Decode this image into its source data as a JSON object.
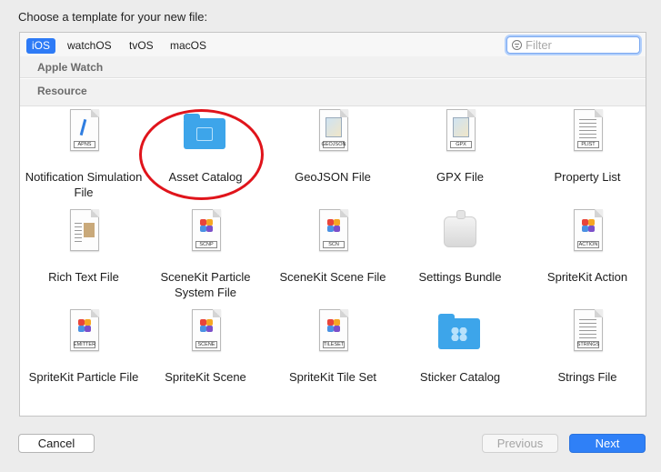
{
  "prompt": "Choose a template for your new file:",
  "tabs": [
    "iOS",
    "watchOS",
    "tvOS",
    "macOS"
  ],
  "active_tab": "iOS",
  "filter": {
    "placeholder": "Filter",
    "value": ""
  },
  "sections": {
    "apple_watch": "Apple Watch",
    "resource": "Resource"
  },
  "templates": [
    {
      "label": "Notification Simulation File",
      "icon": "apns-file-icon",
      "tag": "APNS"
    },
    {
      "label": "Asset Catalog",
      "icon": "asset-catalog-folder-icon"
    },
    {
      "label": "GeoJSON File",
      "icon": "geojson-file-icon",
      "tag": "GEOJSON"
    },
    {
      "label": "GPX File",
      "icon": "gpx-file-icon",
      "tag": "GPX"
    },
    {
      "label": "Property List",
      "icon": "plist-file-icon",
      "tag": "PLIST"
    },
    {
      "label": "Rich Text File",
      "icon": "rich-text-file-icon"
    },
    {
      "label": "SceneKit Particle System File",
      "icon": "scnp-file-icon",
      "tag": "SCNP"
    },
    {
      "label": "SceneKit Scene File",
      "icon": "scn-file-icon",
      "tag": "SCN"
    },
    {
      "label": "Settings Bundle",
      "icon": "settings-bundle-icon"
    },
    {
      "label": "SpriteKit Action",
      "icon": "action-file-icon",
      "tag": "ACTION"
    },
    {
      "label": "SpriteKit Particle File",
      "icon": "emitter-file-icon",
      "tag": "EMITTER"
    },
    {
      "label": "SpriteKit Scene",
      "icon": "scene-file-icon",
      "tag": "SCENE"
    },
    {
      "label": "SpriteKit Tile Set",
      "icon": "tileset-file-icon",
      "tag": "TILESET"
    },
    {
      "label": "Sticker Catalog",
      "icon": "sticker-catalog-folder-icon"
    },
    {
      "label": "Strings File",
      "icon": "strings-file-icon",
      "tag": "STRINGS"
    }
  ],
  "buttons": {
    "cancel": "Cancel",
    "previous": "Previous",
    "next": "Next"
  },
  "colors": {
    "accent": "#2e7bf6",
    "folder": "#3da5ea",
    "annotation_circle": "#e0141b"
  }
}
